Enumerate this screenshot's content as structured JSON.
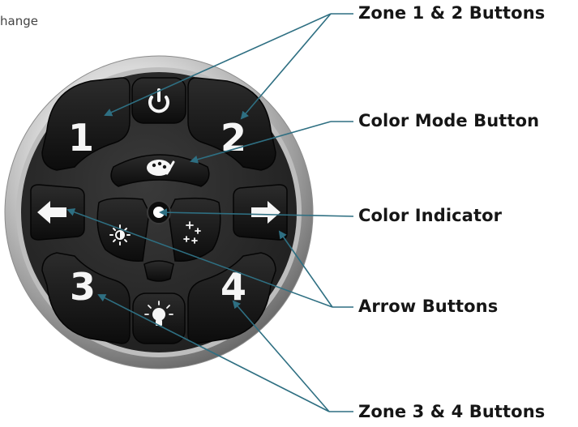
{
  "corner_text": "hange",
  "callouts": {
    "zone12": "Zone 1 & 2 Buttons",
    "color_mode": "Color Mode Button",
    "color_indicator": "Color Indicator",
    "arrows": "Arrow Buttons",
    "zone34": "Zone 3 & 4 Buttons"
  },
  "remote": {
    "zone_labels": [
      "1",
      "2",
      "3",
      "4"
    ],
    "arrow_left": "←",
    "arrow_right": "→"
  },
  "colors": {
    "leader_line": "#2e6f82",
    "bezel": "#d8d8d8",
    "face": "#2a2a2a",
    "button": "#141414",
    "label": "#f6f6f6"
  }
}
